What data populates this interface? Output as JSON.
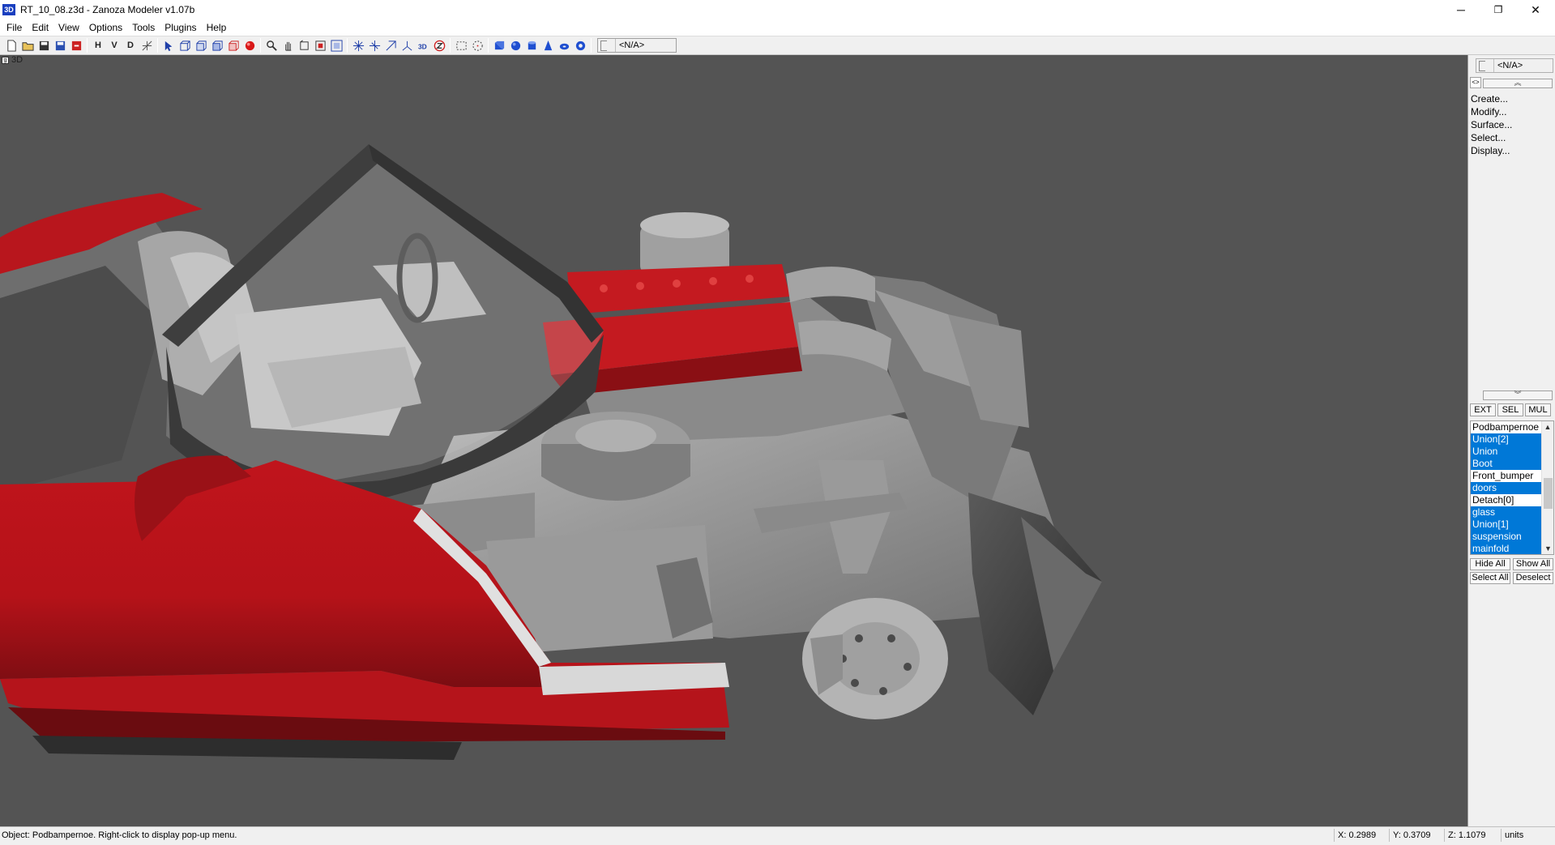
{
  "window": {
    "title": "RT_10_08.z3d - Zanoza Modeler v1.07b",
    "app_icon_text": "3D",
    "controls": {
      "minimize": "─",
      "maximize": "❐",
      "close": "✕"
    }
  },
  "menu": [
    "File",
    "Edit",
    "View",
    "Options",
    "Tools",
    "Plugins",
    "Help"
  ],
  "toolbar": {
    "letter_buttons": {
      "h": "H",
      "v": "V",
      "d": "D"
    },
    "combo_value": "<N/A>"
  },
  "viewport": {
    "label": "3D",
    "menu_button": "g",
    "background_color": "#545454",
    "body_color": "#c0141c",
    "part_color": "#9a9a9a"
  },
  "right_panel": {
    "combo_value": "<N/A>",
    "toggle": "<>",
    "scroll_up": "︽",
    "scroll_down": "︾",
    "commands": [
      "Create...",
      "Modify...",
      "Surface...",
      "Select...",
      "Display..."
    ],
    "tabs": [
      "EXT",
      "SEL",
      "MUL"
    ],
    "objects": [
      {
        "name": "Podbampernoe",
        "selected": false
      },
      {
        "name": "Union[2]",
        "selected": true
      },
      {
        "name": "Union",
        "selected": true
      },
      {
        "name": "Boot",
        "selected": true
      },
      {
        "name": "Front_bumper",
        "selected": false
      },
      {
        "name": "doors",
        "selected": true
      },
      {
        "name": "Detach[0]",
        "selected": false
      },
      {
        "name": "glass",
        "selected": true
      },
      {
        "name": "Union[1]",
        "selected": true
      },
      {
        "name": "suspension",
        "selected": true
      },
      {
        "name": "mainfold",
        "selected": true
      }
    ],
    "list_scroll_up": "▲",
    "list_scroll_down": "▼",
    "buttons": {
      "hide_all": "Hide All",
      "show_all": "Show All",
      "select_all": "Select All",
      "deselect": "Deselect"
    }
  },
  "status": {
    "message": "Object: Podbampernoe. Right-click to display pop-up menu.",
    "x": "X: 0.2989",
    "y": "Y: 0.3709",
    "z": "Z: 1.1079",
    "units": "units"
  }
}
